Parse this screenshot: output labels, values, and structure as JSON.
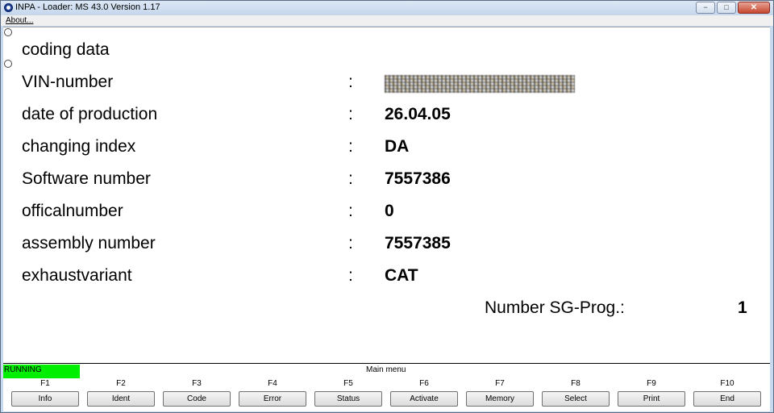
{
  "window": {
    "title": "INPA - Loader:  MS 43.0 Version 1.17",
    "controls": {
      "minimize": "−",
      "restore": "□",
      "close": "✕"
    }
  },
  "menubar": {
    "items": [
      "About..."
    ]
  },
  "coding": {
    "heading": "coding data",
    "separator": ":",
    "rows": [
      {
        "label": "VIN-number",
        "value": ""
      },
      {
        "label": "date of production",
        "value": "26.04.05"
      },
      {
        "label": "changing index",
        "value": "DA"
      },
      {
        "label": "Software number",
        "value": "7557386"
      },
      {
        "label": "officalnumber",
        "value": "0"
      },
      {
        "label": "assembly number",
        "value": "7557385"
      },
      {
        "label": "exhaustvariant",
        "value": "CAT"
      }
    ],
    "sg_prog": {
      "label": "Number SG-Prog.:",
      "value": "1"
    }
  },
  "status": {
    "text": "RUNNING",
    "color": "#00ee00"
  },
  "menu_title": "Main menu",
  "function_keys": [
    {
      "key": "F1",
      "label": "Info"
    },
    {
      "key": "F2",
      "label": "Ident"
    },
    {
      "key": "F3",
      "label": "Code"
    },
    {
      "key": "F4",
      "label": "Error"
    },
    {
      "key": "F5",
      "label": "Status"
    },
    {
      "key": "F6",
      "label": "Activate"
    },
    {
      "key": "F7",
      "label": "Memory"
    },
    {
      "key": "F8",
      "label": "Select"
    },
    {
      "key": "F9",
      "label": "Print"
    },
    {
      "key": "F10",
      "label": "End"
    }
  ]
}
